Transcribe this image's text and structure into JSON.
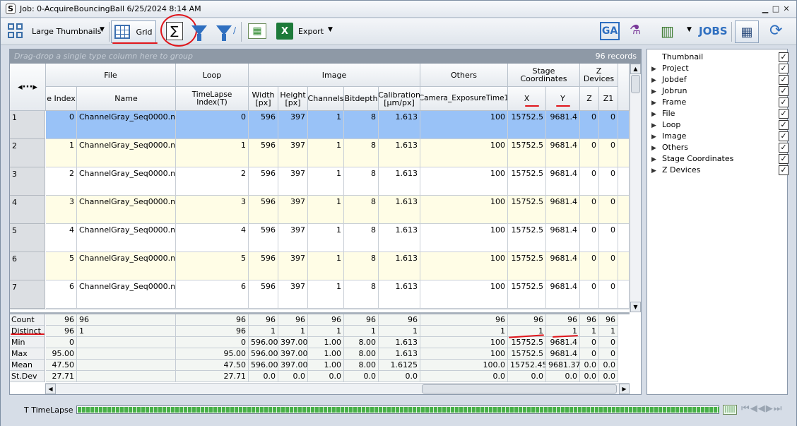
{
  "window": {
    "title": "Job: 0-AcquireBouncingBall 6/25/2024 8:14 AM"
  },
  "toolbar": {
    "view_label": "Large Thumbnails",
    "grid_label": "Grid",
    "export_label": "Export",
    "jobs_label": "JOBS"
  },
  "grid": {
    "group_hint": "Drag-drop a single type column here to group",
    "records": "96 records",
    "groups": [
      "File",
      "Loop",
      "Image",
      "Others",
      "Stage Coordinates",
      "Z Devices"
    ],
    "columns": [
      "e Index",
      "Name",
      "TimeLapse Index(T)",
      "Width [px]",
      "Height [px]",
      "Channels",
      "Bitdepth",
      "Calibration [µm/px]",
      "Camera_ExposureTime1",
      "X",
      "Y",
      "Z",
      "Z1"
    ],
    "rows": [
      {
        "n": "1",
        "idx": "0",
        "name": "ChannelGray_Seq0000.nd2",
        "t": "0",
        "w": "596",
        "h": "397",
        "ch": "1",
        "bd": "8",
        "cal": "1.613",
        "exp": "100",
        "x": "15752.5",
        "y": "9681.4",
        "z": "0",
        "z1": "0"
      },
      {
        "n": "2",
        "idx": "1",
        "name": "ChannelGray_Seq0000.nd2",
        "t": "1",
        "w": "596",
        "h": "397",
        "ch": "1",
        "bd": "8",
        "cal": "1.613",
        "exp": "100",
        "x": "15752.5",
        "y": "9681.4",
        "z": "0",
        "z1": "0"
      },
      {
        "n": "3",
        "idx": "2",
        "name": "ChannelGray_Seq0000.nd2",
        "t": "2",
        "w": "596",
        "h": "397",
        "ch": "1",
        "bd": "8",
        "cal": "1.613",
        "exp": "100",
        "x": "15752.5",
        "y": "9681.4",
        "z": "0",
        "z1": "0"
      },
      {
        "n": "4",
        "idx": "3",
        "name": "ChannelGray_Seq0000.nd2",
        "t": "3",
        "w": "596",
        "h": "397",
        "ch": "1",
        "bd": "8",
        "cal": "1.613",
        "exp": "100",
        "x": "15752.5",
        "y": "9681.4",
        "z": "0",
        "z1": "0"
      },
      {
        "n": "5",
        "idx": "4",
        "name": "ChannelGray_Seq0000.nd2",
        "t": "4",
        "w": "596",
        "h": "397",
        "ch": "1",
        "bd": "8",
        "cal": "1.613",
        "exp": "100",
        "x": "15752.5",
        "y": "9681.4",
        "z": "0",
        "z1": "0"
      },
      {
        "n": "6",
        "idx": "5",
        "name": "ChannelGray_Seq0000.nd2",
        "t": "5",
        "w": "596",
        "h": "397",
        "ch": "1",
        "bd": "8",
        "cal": "1.613",
        "exp": "100",
        "x": "15752.5",
        "y": "9681.4",
        "z": "0",
        "z1": "0"
      },
      {
        "n": "7",
        "idx": "6",
        "name": "ChannelGray_Seq0000.nd2",
        "t": "6",
        "w": "596",
        "h": "397",
        "ch": "1",
        "bd": "8",
        "cal": "1.613",
        "exp": "100",
        "x": "15752.5",
        "y": "9681.4",
        "z": "0",
        "z1": "0"
      }
    ],
    "stats": [
      {
        "label": "Count",
        "vals": [
          "96",
          "96",
          "96",
          "96",
          "96",
          "96",
          "96",
          "96",
          "96",
          "96",
          "96",
          "96",
          "96"
        ]
      },
      {
        "label": "Distinct",
        "vals": [
          "96",
          "1",
          "96",
          "1",
          "1",
          "1",
          "1",
          "1",
          "1",
          "1",
          "1",
          "1",
          "1"
        ]
      },
      {
        "label": "Min",
        "vals": [
          "0",
          "",
          "0",
          "596.00",
          "397.00",
          "1.00",
          "8.00",
          "1.613",
          "100",
          "15752.5",
          "9681.4",
          "0",
          "0"
        ]
      },
      {
        "label": "Max",
        "vals": [
          "95.00",
          "",
          "95.00",
          "596.00",
          "397.00",
          "1.00",
          "8.00",
          "1.613",
          "100",
          "15752.5",
          "9681.4",
          "0",
          "0"
        ]
      },
      {
        "label": "Mean",
        "vals": [
          "47.50",
          "",
          "47.50",
          "596.00",
          "397.00",
          "1.00",
          "8.00",
          "1.6125",
          "100.0",
          "15752.45",
          "9681.37",
          "0.0",
          "0.0"
        ]
      },
      {
        "label": "St.Dev",
        "vals": [
          "27.71",
          "",
          "27.71",
          "0.0",
          "0.0",
          "0.0",
          "0.0",
          "0.0",
          "0.0",
          "0.0",
          "0.0",
          "0.0",
          "0.0"
        ]
      }
    ]
  },
  "fields_panel": {
    "items": [
      "Thumbnail",
      "Project",
      "Jobdef",
      "Jobrun",
      "Frame",
      "File",
      "Loop",
      "Image",
      "Others",
      "Stage Coordinates",
      "Z Devices"
    ]
  },
  "timeline": {
    "label": "T  TimeLapse",
    "progress": 1.0
  },
  "colors": {
    "selected_row": "#99c2f7",
    "alt_row": "#fffde6",
    "annotation": "#e0151b"
  }
}
